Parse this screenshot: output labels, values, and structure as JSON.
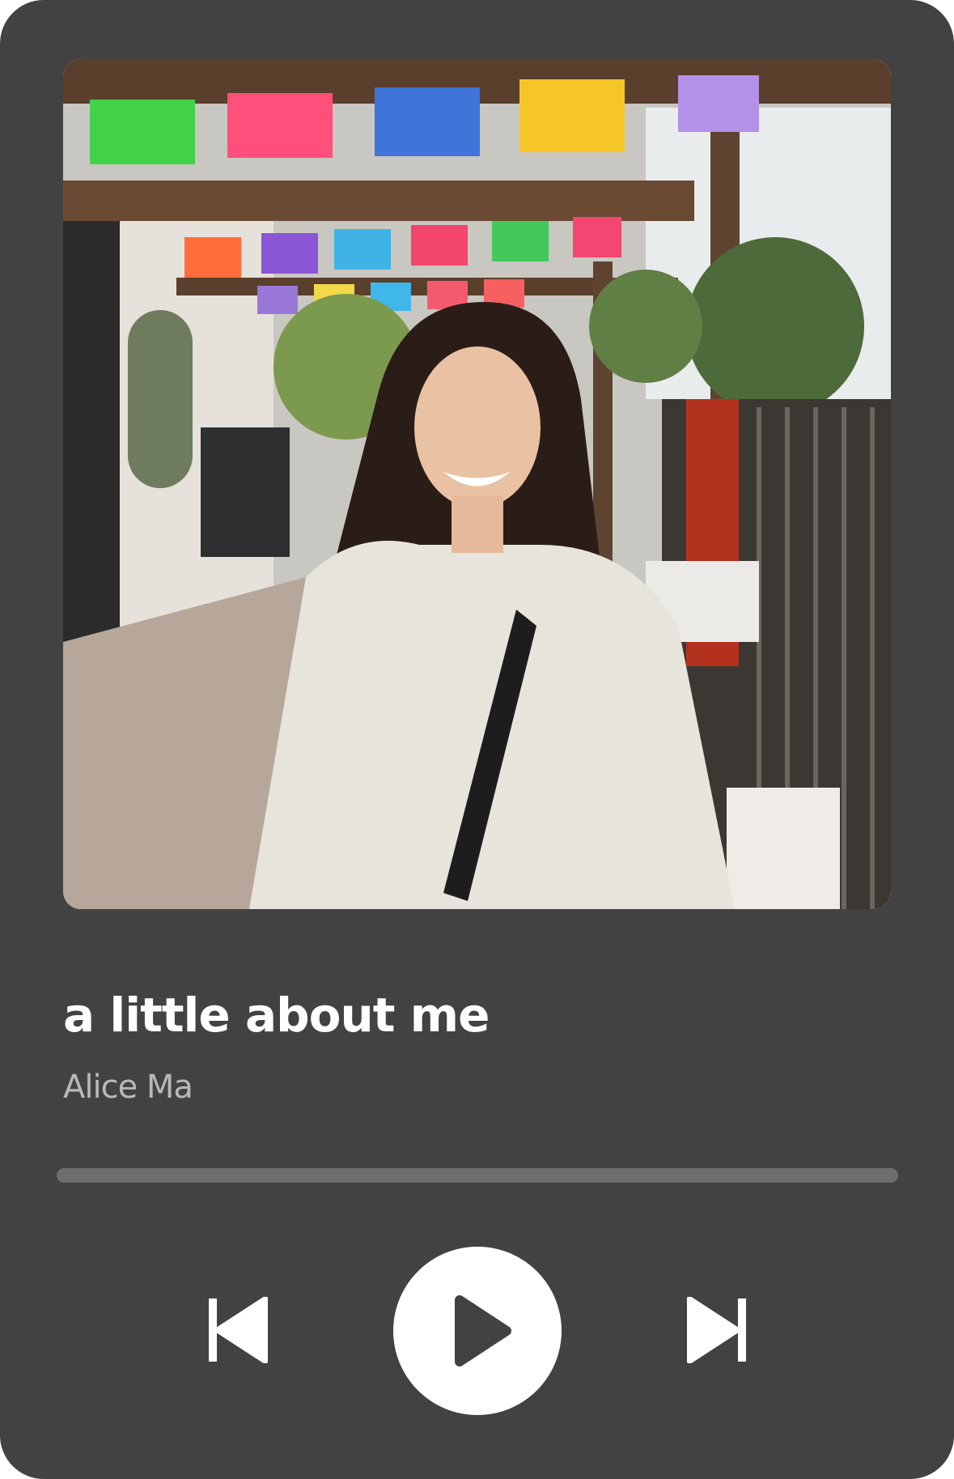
{
  "track": {
    "title": "a little about me",
    "artist": "Alice Ma"
  },
  "artwork": {
    "alt": "Photo of a smiling woman with long dark hair in a fluffy white jacket under colorful papel picado banners"
  },
  "progress": {
    "fraction": 0
  },
  "controls": {
    "previous_icon": "skip-previous-icon",
    "play_icon": "play-icon",
    "next_icon": "skip-next-icon"
  },
  "colors": {
    "card_background": "#424242",
    "title_text": "#ffffff",
    "artist_text": "#b9b9b9",
    "progress_track": "#6e6e6e",
    "play_button_bg": "#ffffff",
    "play_icon": "#424242",
    "control_icon": "#ffffff"
  }
}
